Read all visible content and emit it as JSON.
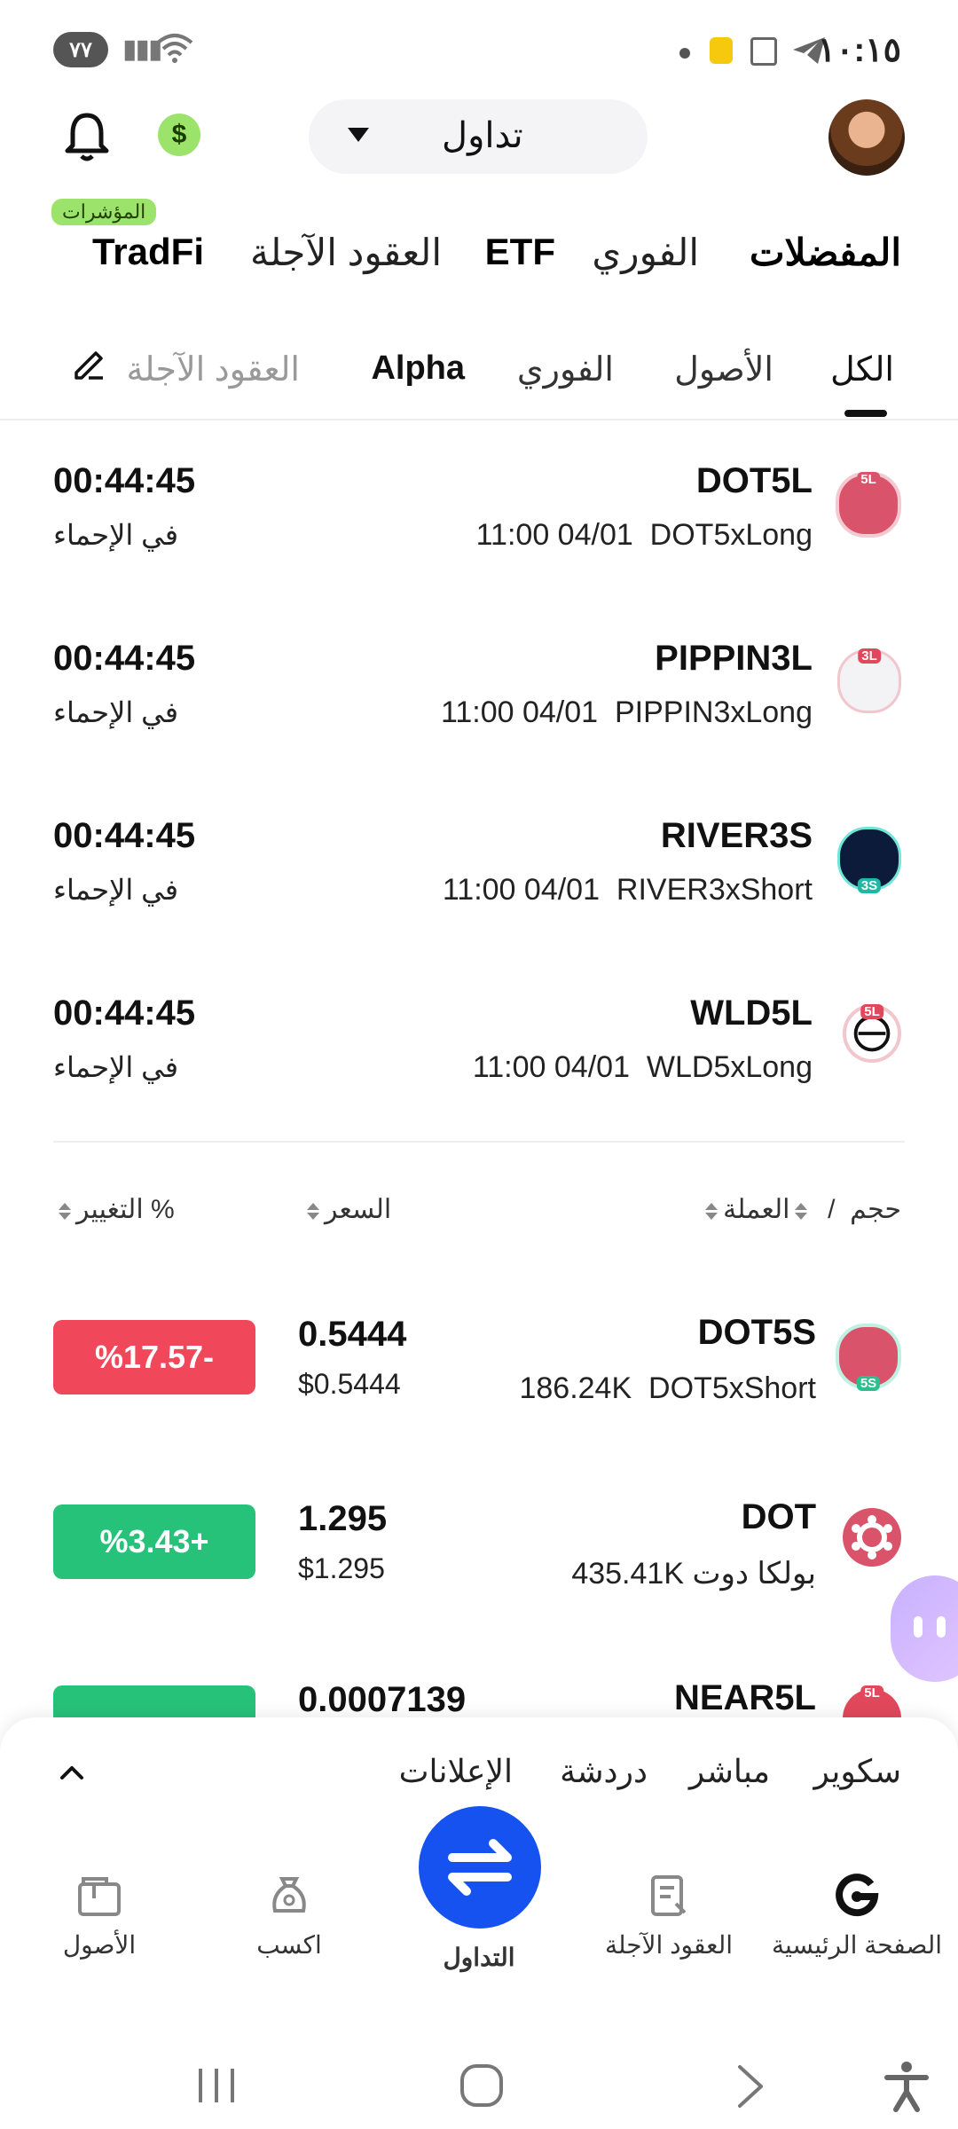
{
  "status_bar": {
    "time": "١٠:١٥",
    "battery": "٧٧"
  },
  "header": {
    "selector_label": "تداول",
    "notification_icon": "bell-icon",
    "currency_icon": "dollar-icon"
  },
  "category_tabs": [
    {
      "label": "المفضلات",
      "active": true
    },
    {
      "label": "الفوري"
    },
    {
      "label": "ETF"
    },
    {
      "label": "العقود الآجلة"
    },
    {
      "label": "TradFi"
    }
  ],
  "category_badge": "المؤشرات",
  "sub_tabs": [
    {
      "label": "الكل",
      "active": true
    },
    {
      "label": "الأصول"
    },
    {
      "label": "الفوري"
    },
    {
      "label": "Alpha"
    },
    {
      "label": "العقود الآجلة"
    }
  ],
  "prelaunch": [
    {
      "symbol": "DOT5L",
      "desc": "DOT5xLong",
      "date": "11:00 04/01",
      "timer": "00:44:45",
      "state": "في الإحماء",
      "tag": "5L"
    },
    {
      "symbol": "PIPPIN3L",
      "desc": "PIPPIN3xLong",
      "date": "11:00 04/01",
      "timer": "00:44:45",
      "state": "في الإحماء",
      "tag": "3L"
    },
    {
      "symbol": "RIVER3S",
      "desc": "RIVER3xShort",
      "date": "11:00 04/01",
      "timer": "00:44:45",
      "state": "في الإحماء",
      "tag": "3S"
    },
    {
      "symbol": "WLD5L",
      "desc": "WLD5xLong",
      "date": "11:00 04/01",
      "timer": "00:44:45",
      "state": "في الإحماء",
      "tag": "5L"
    }
  ],
  "columns": {
    "coin": "العملة",
    "sep": "/",
    "volume": "حجم",
    "price": "السعر",
    "change": "التغيير %"
  },
  "market": [
    {
      "symbol": "DOT5S",
      "volume": "186.24K",
      "name": "DOT5xShort",
      "price": "0.5444",
      "price_usd": "$0.5444",
      "change": "%17.57-",
      "direction": "neg",
      "tag": "5S"
    },
    {
      "symbol": "DOT",
      "volume": "435.41K",
      "name": "بولكا دوت",
      "price": "1.295",
      "price_usd": "$1.295",
      "change": "%3.43+",
      "direction": "pos",
      "tag": ""
    },
    {
      "symbol": "NEAR5L",
      "volume": "",
      "name": "",
      "price": "0.0007139",
      "price_usd": "",
      "change": "",
      "direction": "pos",
      "tag": "5L"
    }
  ],
  "live_tabs": [
    "سكوير",
    "مباشر",
    "دردشة",
    "الإعلانات"
  ],
  "bottom_nav": [
    {
      "label": "الصفحة الرئيسية",
      "icon": "home-icon"
    },
    {
      "label": "العقود الآجلة",
      "icon": "futures-icon"
    },
    {
      "label": "التداول",
      "icon": "swap-icon"
    },
    {
      "label": "اكسب",
      "icon": "earn-icon"
    },
    {
      "label": "الأصول",
      "icon": "wallet-icon"
    }
  ]
}
